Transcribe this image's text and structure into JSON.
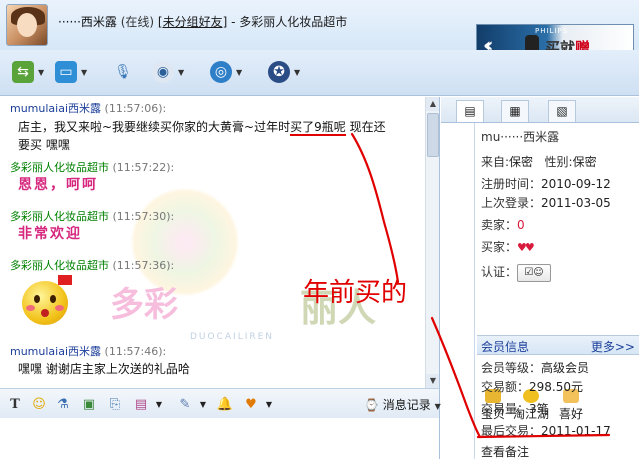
{
  "window": {
    "contact_nick": "······西米露",
    "status": "(在线)",
    "group": "[未分组好友]",
    "separator": " - ",
    "shop_name": "多彩丽人化妆品超市"
  },
  "ad": {
    "brand": "PHILIPS",
    "text_a": "买",
    "text_b": "就",
    "text_c": "赠"
  },
  "toolbar": {
    "items": [
      "transfer-icon",
      "folder-icon",
      "mic-icon",
      "camera-icon",
      "remote-icon",
      "police-icon"
    ]
  },
  "chat": {
    "messages": [
      {
        "sender": "mumulaiai西米露",
        "time": "(11:57:06):",
        "text_a": "店主，我又来啦~我要继续买你家的大黄膏~过年时",
        "text_underlined": "买了9瓶呢",
        "text_b": "现在还",
        "text_c": "要买  嘿嘿"
      },
      {
        "sender": "多彩丽人化妆品超市",
        "time": "(11:57:22):",
        "text": "恩恩，呵呵"
      },
      {
        "sender": "多彩丽人化妆品超市",
        "time": "(11:57:30):",
        "text": "非常欢迎"
      },
      {
        "sender": "多彩丽人化妆品超市",
        "time": "(11:57:36):",
        "text": ""
      },
      {
        "sender": "mumulaiai西米露",
        "time": "(11:57:46):",
        "text": "嘿嘿  谢谢店主家上次送的礼品哈"
      }
    ],
    "watermark": {
      "cn_a": "多彩",
      "cn_b": "丽人",
      "latin": "DUOCAILIREN"
    }
  },
  "input_toolbar": {
    "history_label": "消息记录"
  },
  "profile": {
    "name": "mu······西米露",
    "from_label": "来自:",
    "from_value": "保密",
    "gender_label": "性别:",
    "gender_value": "保密",
    "register_label": "注册时间：",
    "register_value": "2010-09-12",
    "last_login_label": "上次登录：",
    "last_login_value": "2011-03-05",
    "seller_label": "卖家：",
    "seller_value": "0",
    "buyer_label": "买家：",
    "cert_label": "认证：",
    "shortcuts": [
      "宝贝",
      "淘江湖",
      "喜好"
    ],
    "member_info_label": "会员信息",
    "more_label": "更多>>",
    "level_label": "会员等级：",
    "level_value": "高级会员",
    "amount_label": "交易额：",
    "amount_value": "298.50元",
    "count_label": "交易量：",
    "count_value": "3笔",
    "last_trade_label": "最后交易：",
    "last_trade_value": "2011-01-17",
    "notes_label": "查看备注"
  },
  "annotation": {
    "text": "年前买的",
    "color": "#e00000"
  }
}
